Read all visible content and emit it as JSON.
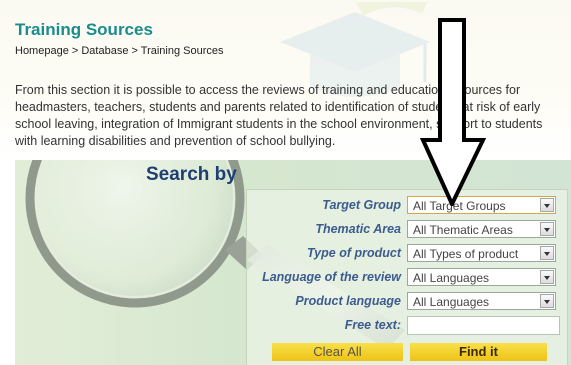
{
  "page": {
    "title": "Training Sources",
    "breadcrumb": "Homepage > Database > Training Sources",
    "intro": "From this section it is possible to access the reviews of training and educational sources for headmasters, teachers, students and parents related to identification of students at risk of early school leaving, integration of Immigrant students in the school environment, support to students with learning disabilities and prevention of school bullying."
  },
  "search": {
    "heading": "Search by",
    "fields": [
      {
        "label": "Target Group",
        "value": "All Target Groups"
      },
      {
        "label": "Thematic Area",
        "value": "All Thematic Areas"
      },
      {
        "label": "Type of product",
        "value": "All Types of product"
      },
      {
        "label": "Language of the review",
        "value": "All Languages"
      },
      {
        "label": "Product language",
        "value": "All Languages"
      }
    ],
    "free_text": {
      "label": "Free text:",
      "value": ""
    },
    "clear_label": "Clear All",
    "find_label": "Find it"
  },
  "colors": {
    "title": "#1a8c8e",
    "label": "#3b5c8e",
    "heading": "#1f3f73",
    "button": "#f3d233"
  },
  "icons": [
    "graduation-cap-watermark",
    "magnifying-glass-graphic",
    "down-arrow-annotation"
  ]
}
